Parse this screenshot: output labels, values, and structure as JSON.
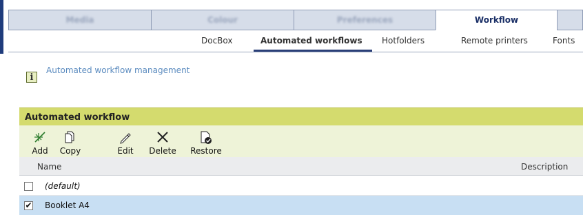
{
  "main_tabs": [
    {
      "label": "Media",
      "active": false
    },
    {
      "label": "Colour",
      "active": false
    },
    {
      "label": "Preferences",
      "active": false
    },
    {
      "label": "Workflow",
      "active": true
    },
    {
      "label": "",
      "active": false
    }
  ],
  "sub_tabs": [
    {
      "label": "DocBox",
      "active": false
    },
    {
      "label": "Automated workflows",
      "active": true
    },
    {
      "label": "Hotfolders",
      "active": false
    },
    {
      "label": "Remote printers",
      "active": false
    },
    {
      "label": "Fonts",
      "active": false
    }
  ],
  "info": {
    "text": "Automated workflow management",
    "icon": "info-icon"
  },
  "panel": {
    "title": "Automated workflow",
    "toolbar": [
      {
        "label": "Add",
        "icon": "add-icon"
      },
      {
        "label": "Copy",
        "icon": "copy-icon"
      },
      {
        "label": "Edit",
        "icon": "edit-icon"
      },
      {
        "label": "Delete",
        "icon": "delete-icon"
      },
      {
        "label": "Restore",
        "icon": "restore-icon"
      }
    ],
    "columns": {
      "name": "Name",
      "description": "Description"
    },
    "rows": [
      {
        "name": "(default)",
        "checked": false,
        "check_glyph": ""
      },
      {
        "name": "Booklet A4",
        "checked": true,
        "check_glyph": "✔"
      }
    ]
  },
  "colors": {
    "accent": "#1f3c7c",
    "panel_header": "#d4db6e",
    "toolbar_bg": "#eef3d8",
    "selected_row": "#c8dff3",
    "info_text": "#5b8bbf"
  }
}
